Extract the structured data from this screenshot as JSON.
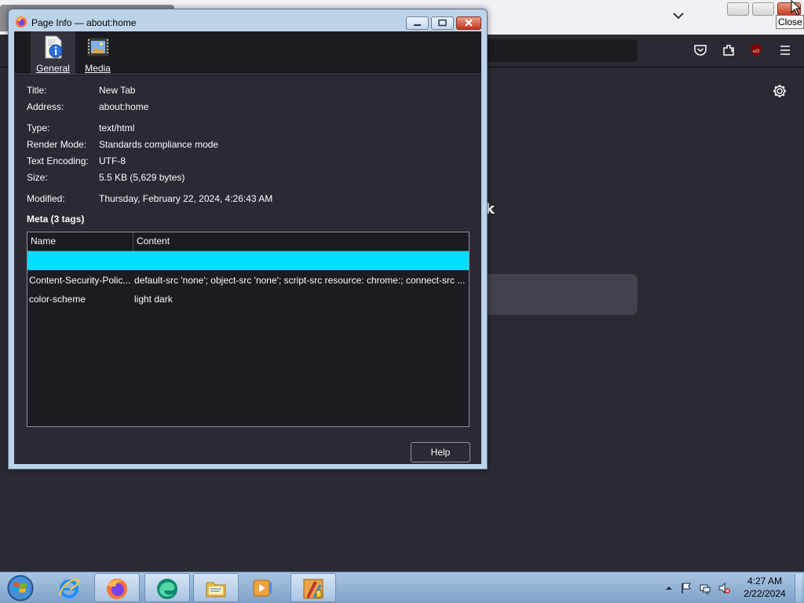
{
  "window": {
    "title": "Page Info — about:home"
  },
  "tooltip": "Close",
  "background_page": {
    "logo_fragment": "k"
  },
  "tabs": [
    {
      "label": "General"
    },
    {
      "label": "Media"
    }
  ],
  "general": {
    "rows": [
      {
        "label": "Title:",
        "value": "New Tab"
      },
      {
        "label": "Address:",
        "value": "about:home"
      },
      {
        "label": "Type:",
        "value": "text/html"
      },
      {
        "label": "Render Mode:",
        "value": "Standards compliance mode"
      },
      {
        "label": "Text Encoding:",
        "value": "UTF-8"
      },
      {
        "label": "Size:",
        "value": "5.5 KB (5,629 bytes)"
      },
      {
        "label": "Modified:",
        "value": "Thursday, February 22, 2024, 4:26:43 AM"
      }
    ]
  },
  "meta": {
    "heading": "Meta (3 tags)",
    "columns": [
      "Name",
      "Content"
    ],
    "rows": [
      {
        "name": "Content-Security-Polic...",
        "content": "default-src 'none'; object-src 'none'; script-src resource: chrome:; connect-src ..."
      },
      {
        "name": "color-scheme",
        "content": "light dark"
      }
    ]
  },
  "help_button": "Help",
  "clock": {
    "time": "4:27 AM",
    "date": "2/22/2024"
  },
  "colors": {
    "selection": "#00ddff",
    "dialog_bg": "#2b2a33",
    "ublock": "#800000"
  }
}
